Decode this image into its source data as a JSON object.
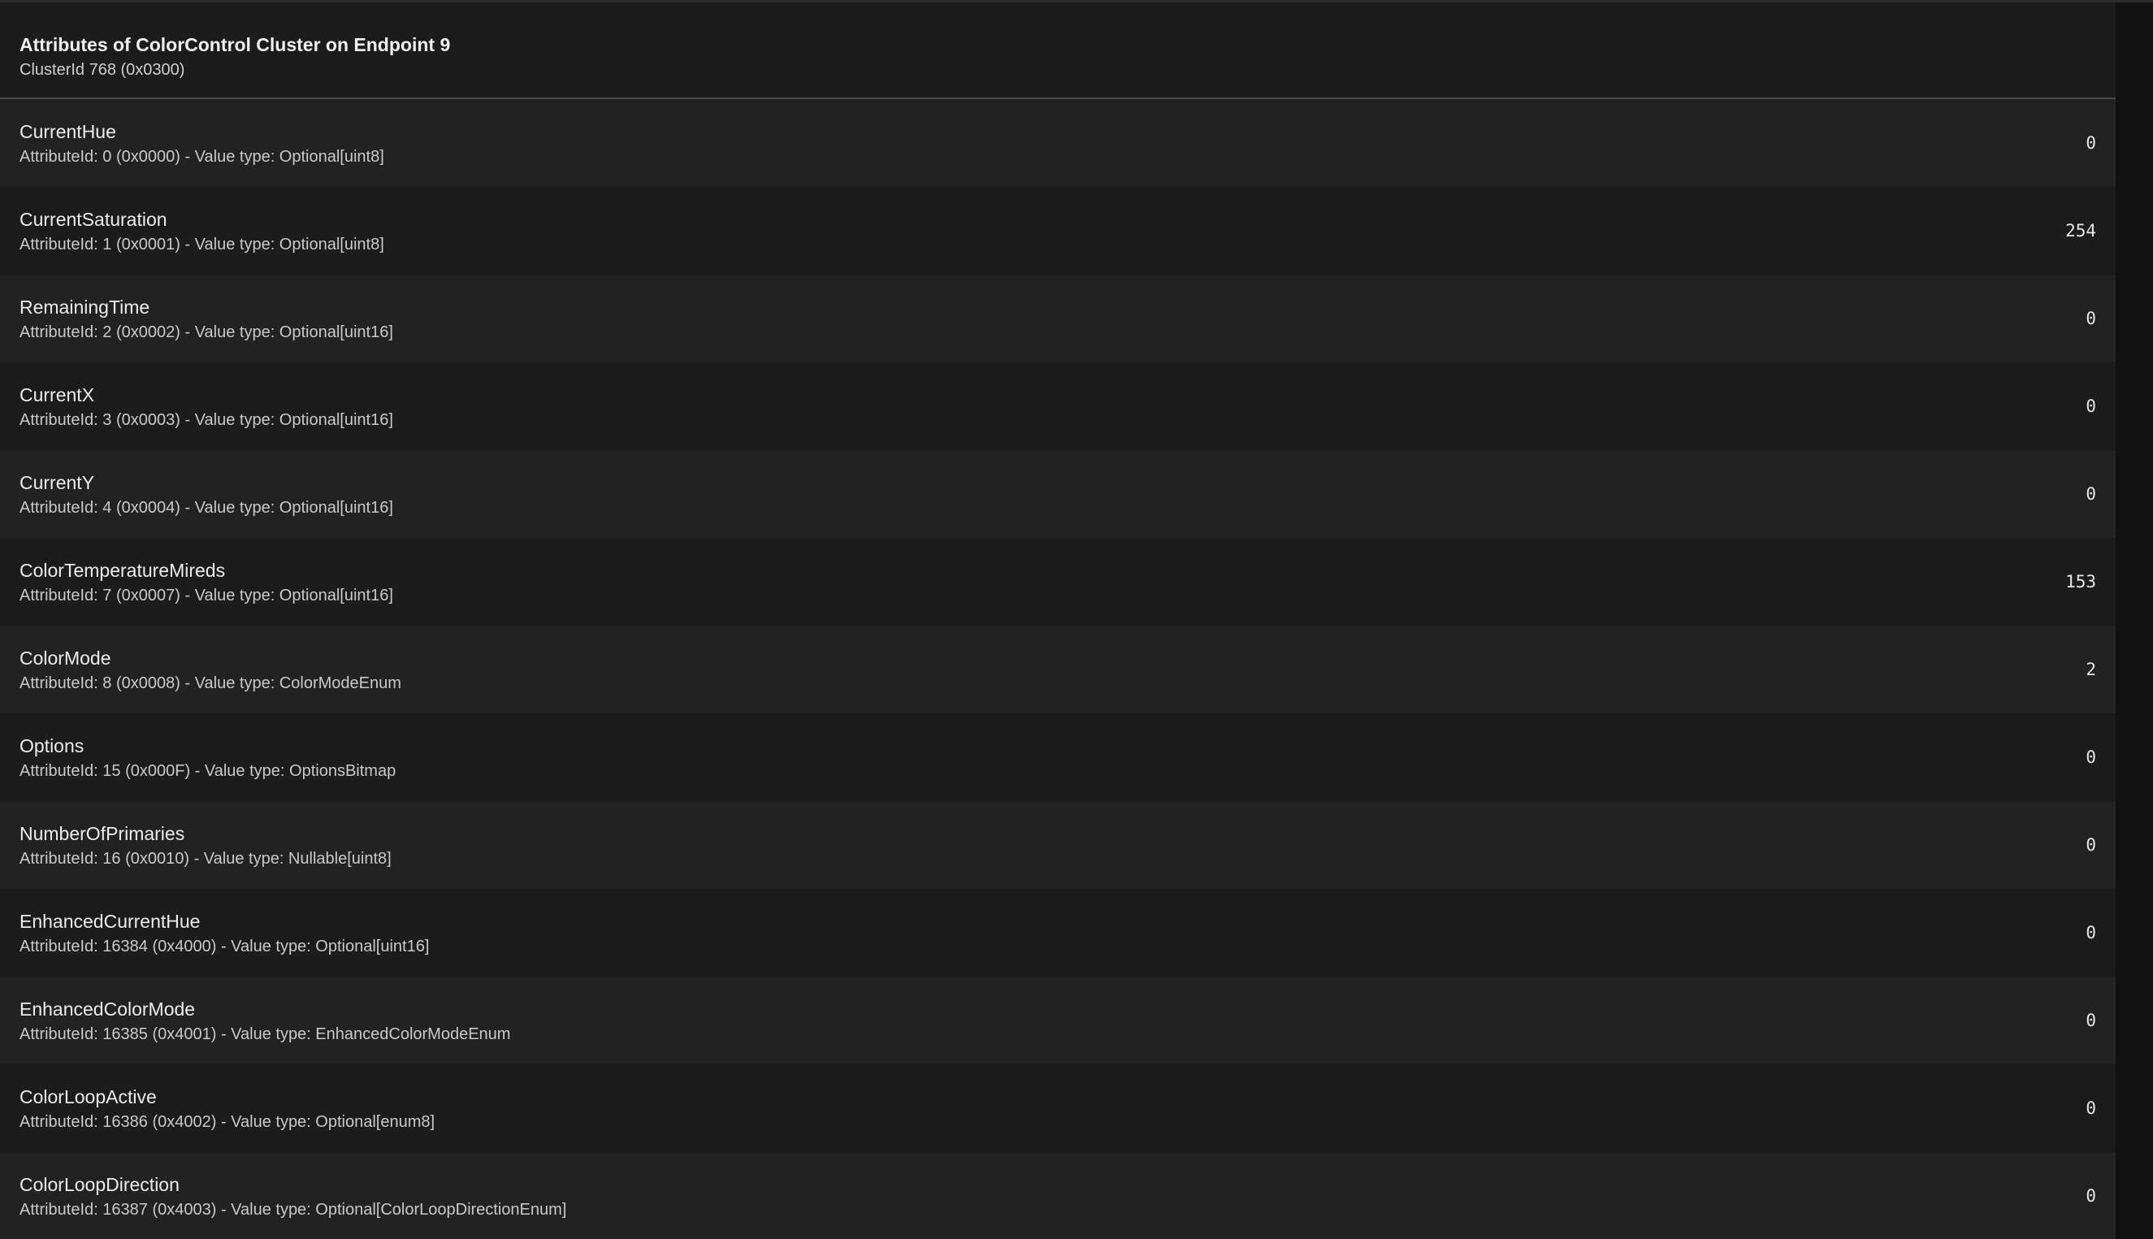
{
  "header": {
    "title": "Attributes of ColorControl Cluster on Endpoint 9",
    "subtitle": "ClusterId 768 (0x0300)"
  },
  "attributes": [
    {
      "name": "CurrentHue",
      "description": "AttributeId: 0 (0x0000) - Value type: Optional[uint8]",
      "value": "0"
    },
    {
      "name": "CurrentSaturation",
      "description": "AttributeId: 1 (0x0001) - Value type: Optional[uint8]",
      "value": "254"
    },
    {
      "name": "RemainingTime",
      "description": "AttributeId: 2 (0x0002) - Value type: Optional[uint16]",
      "value": "0"
    },
    {
      "name": "CurrentX",
      "description": "AttributeId: 3 (0x0003) - Value type: Optional[uint16]",
      "value": "0"
    },
    {
      "name": "CurrentY",
      "description": "AttributeId: 4 (0x0004) - Value type: Optional[uint16]",
      "value": "0"
    },
    {
      "name": "ColorTemperatureMireds",
      "description": "AttributeId: 7 (0x0007) - Value type: Optional[uint16]",
      "value": "153"
    },
    {
      "name": "ColorMode",
      "description": "AttributeId: 8 (0x0008) - Value type: ColorModeEnum",
      "value": "2"
    },
    {
      "name": "Options",
      "description": "AttributeId: 15 (0x000F) - Value type: OptionsBitmap",
      "value": "0"
    },
    {
      "name": "NumberOfPrimaries",
      "description": "AttributeId: 16 (0x0010) - Value type: Nullable[uint8]",
      "value": "0"
    },
    {
      "name": "EnhancedCurrentHue",
      "description": "AttributeId: 16384 (0x4000) - Value type: Optional[uint16]",
      "value": "0"
    },
    {
      "name": "EnhancedColorMode",
      "description": "AttributeId: 16385 (0x4001) - Value type: EnhancedColorModeEnum",
      "value": "0"
    },
    {
      "name": "ColorLoopActive",
      "description": "AttributeId: 16386 (0x4002) - Value type: Optional[enum8]",
      "value": "0"
    },
    {
      "name": "ColorLoopDirection",
      "description": "AttributeId: 16387 (0x4003) - Value type: Optional[ColorLoopDirectionEnum]",
      "value": "0"
    }
  ],
  "colors": {
    "background": "#111111",
    "card": "#1c1c1c",
    "row_alt": "#222222",
    "divider": "#4a4a4a",
    "text_primary": "#ececec",
    "text_secondary": "#c9c9c9"
  }
}
